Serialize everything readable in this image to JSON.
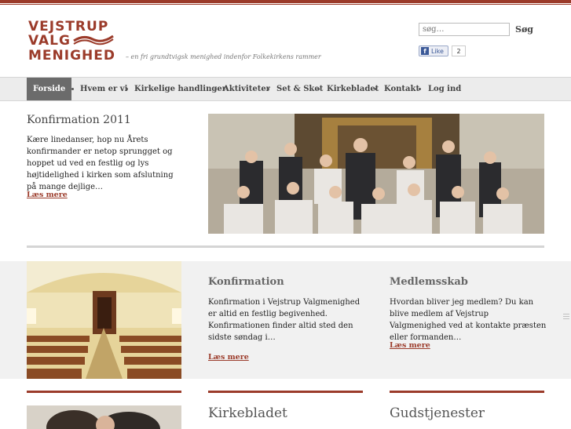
{
  "logo": {
    "line1": "VEJSTRUP",
    "line2": "VALG",
    "line3": "MENIGHED"
  },
  "tagline": "– en fri grundtvigsk menighed indenfor Folkekirkens rammer",
  "search": {
    "placeholder": "søg…",
    "button_label": "Søg"
  },
  "facebook": {
    "like_label": "Like",
    "count": "2"
  },
  "nav": {
    "items": [
      {
        "label": "Forside"
      },
      {
        "label": "Hvem er vi"
      },
      {
        "label": "Kirkelige handlinger"
      },
      {
        "label": "Aktiviteter"
      },
      {
        "label": "Set & Sket"
      },
      {
        "label": "Kirkebladet"
      },
      {
        "label": "Kontakt"
      },
      {
        "label": "Log ind"
      }
    ]
  },
  "feature": {
    "title": "Konfirmation 2011",
    "text": "Kære linedanser, hop nu Årets konfirmander er netop sprungget og hoppet ud ved en festlig og lys højtidelighed i kirken som afslutning på mange dejlige…",
    "read_more": "Læs mere"
  },
  "columns": [
    {
      "title": "Konfirmation",
      "text": "Konfirmation i Vejstrup Valgmenighed er altid en festlig begivenhed. Konfirmationen finder altid sted den sidste søndag i…",
      "read_more": "Læs mere"
    },
    {
      "title": "Medlemsskab",
      "text": "Hvordan bliver jeg medlem? Du kan blive medlem af Vejstrup Valgmenighed ved at kontakte præsten eller formanden…",
      "read_more": "Læs mere"
    }
  ],
  "sections": [
    {
      "title": "Kirkebladet"
    },
    {
      "title": "Gudstjenester"
    }
  ],
  "colors": {
    "brand": "#9b3b2a",
    "nav_active": "#6b6b6b",
    "band": "#f1f1f1"
  }
}
